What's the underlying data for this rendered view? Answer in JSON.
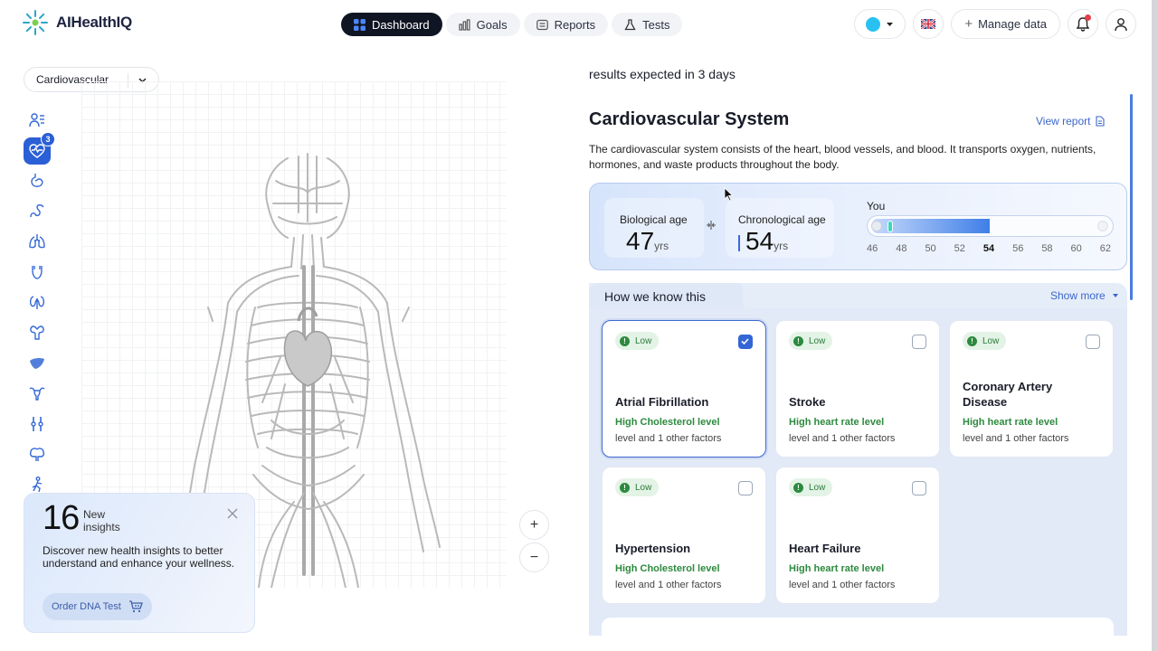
{
  "app": {
    "name": "AIHealthIQ"
  },
  "nav": {
    "tabs": [
      {
        "label": "Dashboard",
        "active": true,
        "icon": "grid-icon"
      },
      {
        "label": "Goals",
        "active": false,
        "icon": "bar-chart-icon"
      },
      {
        "label": "Reports",
        "active": false,
        "icon": "report-icon"
      },
      {
        "label": "Tests",
        "active": false,
        "icon": "flask-icon"
      }
    ]
  },
  "header": {
    "manage_data_label": "Manage data",
    "language_flag": "uk-flag-icon",
    "color_accent": "#29c1f2"
  },
  "left": {
    "system_select": "Cardiovascular",
    "organ_badge": "3",
    "organs": [
      "profile-list-icon",
      "heart-pulse-icon",
      "stomach-icon",
      "intestine-icon",
      "lungs-icon",
      "bladder-icon",
      "kidneys-icon",
      "reproductive-icon",
      "liver-icon",
      "uterus-icon",
      "joints-icon",
      "brain-icon",
      "skeleton-icon"
    ],
    "zoom_in": "+",
    "zoom_out": "−"
  },
  "insights": {
    "count": "16",
    "label_line1": "New",
    "label_line2": "insights",
    "description": "Discover new health insights to better understand and enhance your wellness.",
    "button_label": "Order DNA Test"
  },
  "right": {
    "expected_text": "results expected in 3 days",
    "title": "Cardiovascular System",
    "view_report": "View report",
    "description": "The cardiovascular system consists of the heart, blood vessels, and blood. It transports oxygen, nutrients, hormones, and waste products throughout the body.",
    "age": {
      "biological_label": "Biological age",
      "biological_value": "47",
      "chronological_label": "Chronological age",
      "chronological_value": "54",
      "unit": "yrs",
      "you_label": "You",
      "scale": [
        "46",
        "48",
        "50",
        "52",
        "54",
        "56",
        "58",
        "60",
        "62"
      ],
      "current_tick": "54"
    },
    "how_title": "How we know this",
    "show_more": "Show more",
    "cards": [
      {
        "risk": "Low",
        "name": "Atrial Fibrillation",
        "factor": "High Cholesterol level",
        "other": "level and 1 other factors",
        "checked": true
      },
      {
        "risk": "Low",
        "name": "Stroke",
        "factor": "High heart rate level",
        "other": "level and 1 other factors",
        "checked": false
      },
      {
        "risk": "Low",
        "name": "Coronary Artery Disease",
        "factor": "High heart rate level",
        "other": "level and 1 other factors",
        "checked": false
      },
      {
        "risk": "Low",
        "name": "Hypertension",
        "factor": "High Cholesterol level",
        "other": "level and 1 other factors",
        "checked": false
      },
      {
        "risk": "Low",
        "name": "Heart Failure",
        "factor": "High heart rate level",
        "other": "level and 1 other factors",
        "checked": false
      }
    ]
  },
  "colors": {
    "accent": "#2a5fd6",
    "link": "#3c67c9",
    "risk_low": "#2c8a3e"
  }
}
